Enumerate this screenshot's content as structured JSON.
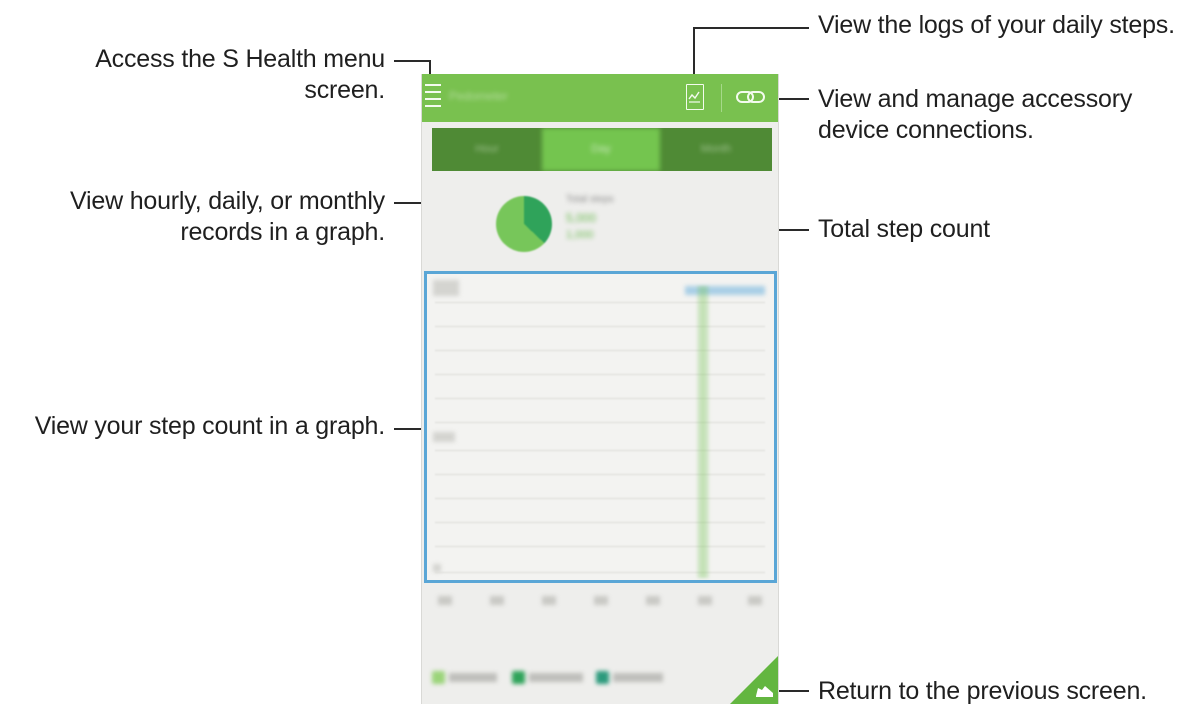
{
  "callouts": {
    "menu_line1": "Access the S Health menu",
    "menu_line2": "screen.",
    "logs": "View the logs of your daily steps.",
    "accessory_line1": "View and manage accessory",
    "accessory_line2": "device connections.",
    "records_line1": "View hourly, daily, or monthly",
    "records_line2": "records in a graph.",
    "total": "Total step count",
    "graph": "View your step count in a graph.",
    "return": "Return to the previous screen."
  },
  "app": {
    "title": "Pedometer",
    "icons": {
      "menu": "hamburger-menu-icon",
      "logs": "step-log-icon",
      "accessory": "link-icon",
      "back": "shoe-icon"
    },
    "tabs": [
      {
        "label": "Hour",
        "selected": false
      },
      {
        "label": "Day",
        "selected": true
      },
      {
        "label": "Month",
        "selected": false
      }
    ],
    "summary": {
      "heading": "Total steps",
      "steps": "5,000",
      "detail": "1,000"
    },
    "colors": {
      "app_bar": "#79c14f",
      "tab_dark": "#4f8a35",
      "tab_selected": "#74c54f",
      "highlight": "#5aa6d6",
      "pie_dark": "#2fa35a",
      "pie_light": "#77c65a"
    }
  }
}
